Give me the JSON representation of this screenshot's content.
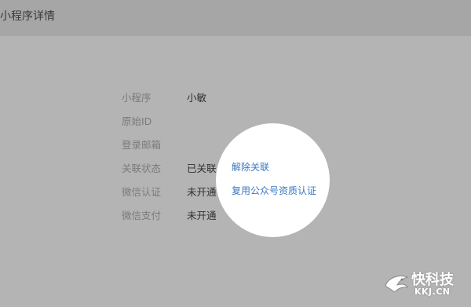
{
  "header": {
    "title": "小程序详情"
  },
  "details": {
    "rows": [
      {
        "label": "小程序",
        "value": "小敏"
      },
      {
        "label": "原始ID",
        "value": ""
      },
      {
        "label": "登录邮箱",
        "value": ""
      },
      {
        "label": "关联状态",
        "value": "已关联",
        "link": "解除关联"
      },
      {
        "label": "微信认证",
        "value": "未开通",
        "link": "复用公众号资质认证"
      },
      {
        "label": "微信支付",
        "value": "未开通"
      }
    ]
  },
  "watermark": {
    "brand": "快科技",
    "domain": "KKJ.CN"
  },
  "colors": {
    "background": "#b4b4b4",
    "header": "#a6a6a6",
    "link": "#3a77c0",
    "spotlight": "#ffffff"
  }
}
